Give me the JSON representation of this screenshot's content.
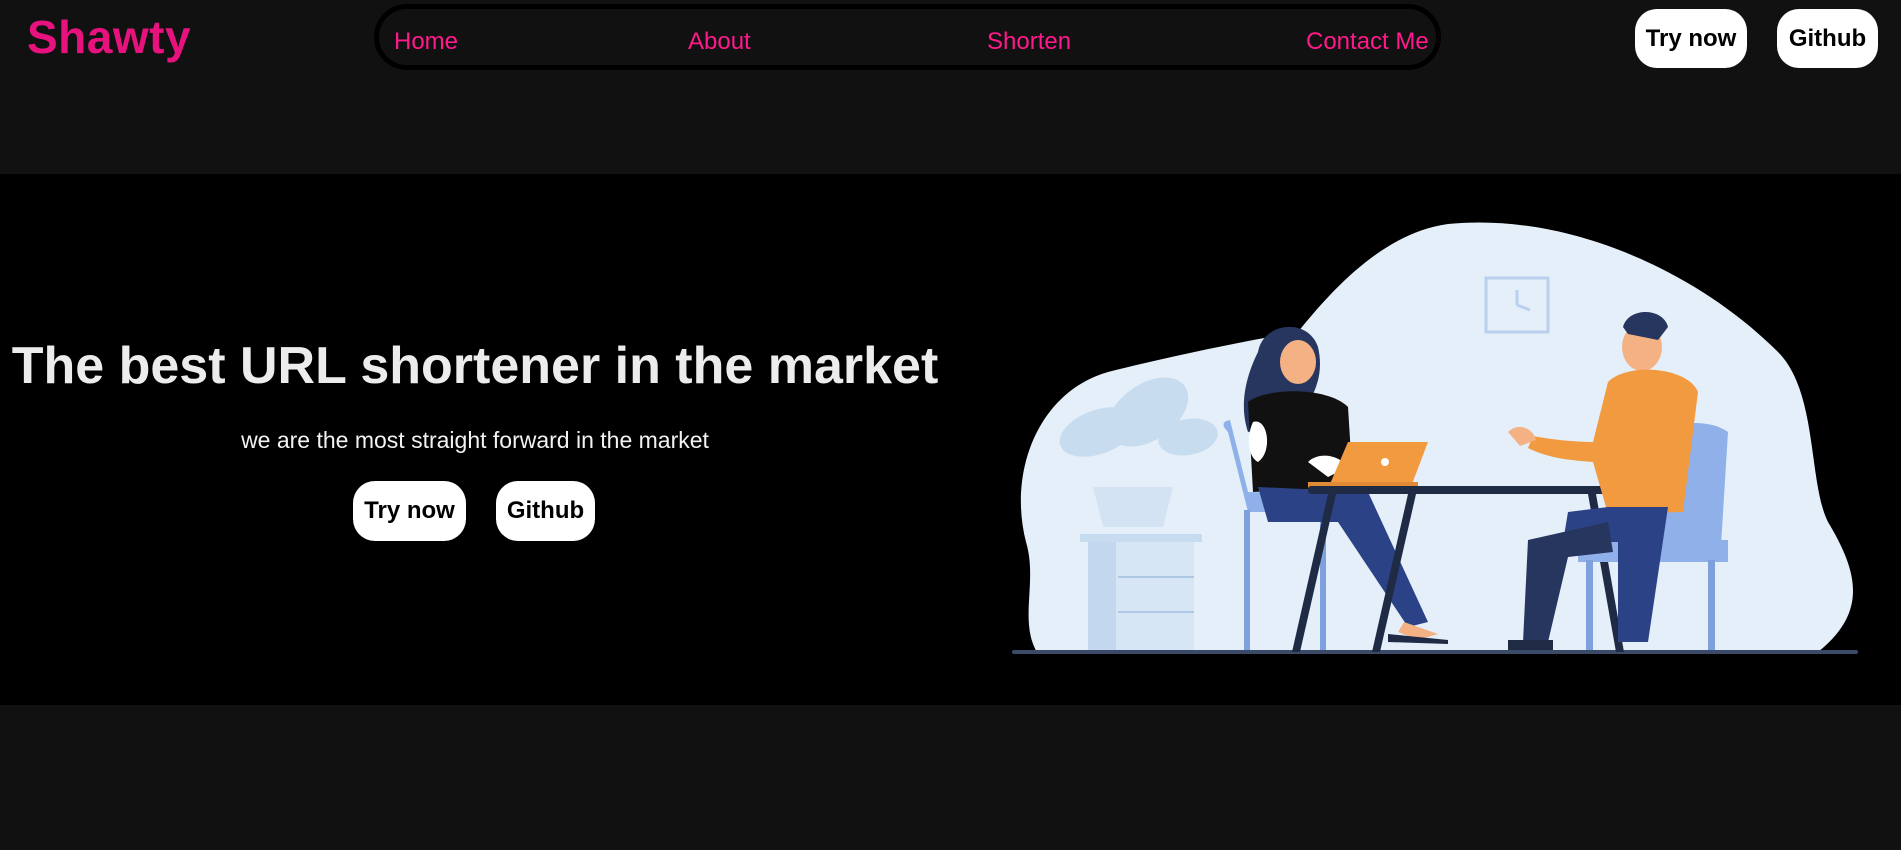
{
  "header": {
    "brand": "Shawty",
    "nav": [
      "Home",
      "About",
      "Shorten",
      "Contact Me"
    ],
    "try_label": "Try now",
    "github_label": "Github"
  },
  "hero": {
    "title": "The best URL shortener in the market",
    "subtitle": "we are the most straight forward in the market",
    "try_label": "Try now",
    "github_label": "Github",
    "illustration": "meeting-illustration"
  },
  "colors": {
    "brand_pink": "#e8127f",
    "nav_link": "#ff1a8c",
    "page_bg": "#111111",
    "hero_bg": "#000000",
    "button_bg": "#ffffff"
  }
}
